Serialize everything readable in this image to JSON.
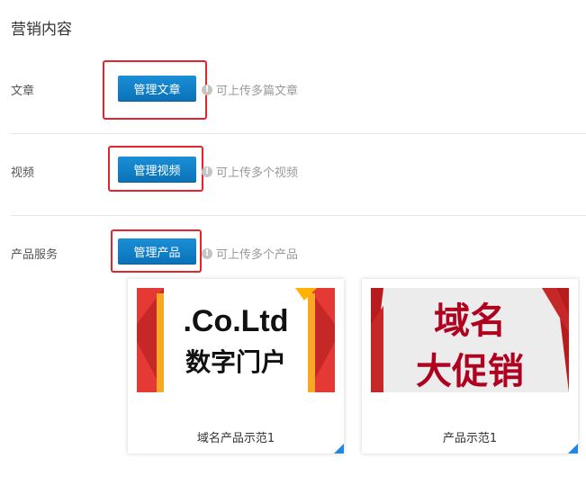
{
  "section_title": "营销内容",
  "rows": [
    {
      "label": "文章",
      "button": "管理文章",
      "hint": "可上传多篇文章"
    },
    {
      "label": "视频",
      "button": "管理视频",
      "hint": "可上传多个视频"
    },
    {
      "label": "产品服务",
      "button": "管理产品",
      "hint": "可上传多个产品"
    }
  ],
  "info_icon_glyph": "!",
  "products": [
    {
      "name": "域名产品示范1",
      "image_text": [
        ".Co.Ltd",
        "数字门户"
      ]
    },
    {
      "name": "产品示范1",
      "image_text": [
        "域名",
        "大促销"
      ]
    }
  ],
  "colors": {
    "button": "#0a72b8",
    "highlight": "#e3262d",
    "corner": "#1e88e5"
  }
}
